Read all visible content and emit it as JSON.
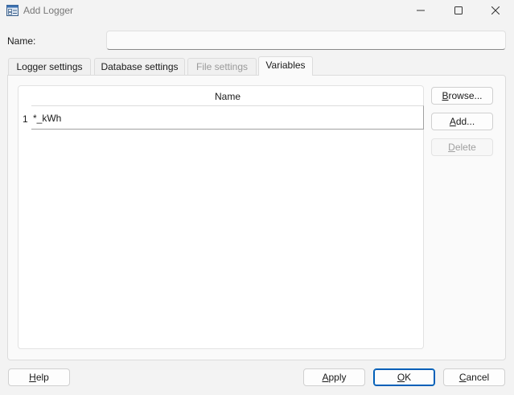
{
  "window": {
    "title": "Add Logger",
    "app_icon": "logger-app-icon",
    "controls": [
      "minimize-icon",
      "maximize-icon",
      "close-icon"
    ]
  },
  "name_field": {
    "label": "Name:",
    "value": "",
    "placeholder": ""
  },
  "tabs": [
    {
      "label": "Logger settings",
      "state": "normal"
    },
    {
      "label": "Database settings",
      "state": "normal"
    },
    {
      "label": "File settings",
      "state": "disabled"
    },
    {
      "label": "Variables",
      "state": "selected"
    }
  ],
  "variables_table": {
    "column_header": "Name",
    "rows": [
      {
        "number": "1",
        "name": "*_kWh"
      }
    ]
  },
  "side_buttons": {
    "browse": {
      "pre": "",
      "key": "B",
      "post": "rowse..."
    },
    "add": {
      "pre": "",
      "key": "A",
      "post": "dd..."
    },
    "delete": {
      "pre": "",
      "key": "D",
      "post": "elete"
    }
  },
  "footer_buttons": {
    "help": {
      "pre": "",
      "key": "H",
      "post": "elp"
    },
    "apply": {
      "pre": "",
      "key": "A",
      "post": "pply"
    },
    "ok": {
      "pre": "",
      "key": "O",
      "post": "K"
    },
    "cancel": {
      "pre": "",
      "key": "C",
      "post": "ancel"
    }
  },
  "colors": {
    "background": "#f3f3f3",
    "accent": "#005fb8",
    "disabled_text": "#a0a0a0"
  }
}
